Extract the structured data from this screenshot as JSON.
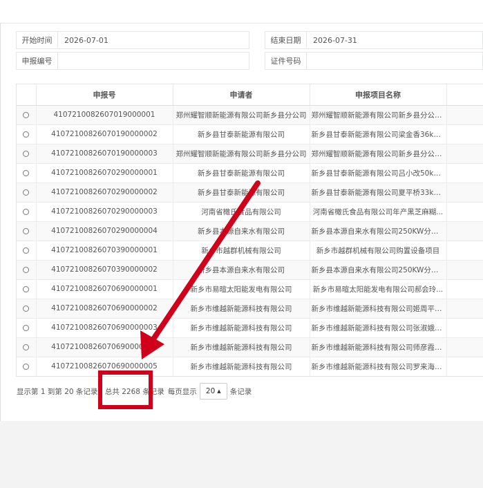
{
  "filters": {
    "start_label": "开始时间",
    "start_value": "2026-07-01",
    "end_label": "结束日期",
    "end_value": "2026-07-31",
    "report_no_label": "申报编号",
    "report_no_value": "",
    "cert_label": "证件号码",
    "cert_value": ""
  },
  "table": {
    "columns": [
      "申报号",
      "申请者",
      "申报项目名称"
    ],
    "rows": [
      {
        "no": "410721008260701900000​1",
        "applicant": "郑州耀智顺新能源有限公司新乡县分公司",
        "project": "郑州耀智顺新能源有限公司新乡县分公司..."
      },
      {
        "no": "41072100826070190000002",
        "applicant": "新乡县甘泰新能源有限公司",
        "project": "新乡县甘泰新能源有限公司梁金香36kW..."
      },
      {
        "no": "41072100826070190000003",
        "applicant": "郑州耀智顺新能源有限公司新乡县分公司",
        "project": "郑州耀智顺新能源有限公司新乡县分公司..."
      },
      {
        "no": "41072100826070290000001",
        "applicant": "新乡县甘泰新能源有限公司",
        "project": "新乡县甘泰新能源有限公司吕小改50kW..."
      },
      {
        "no": "41072100826070290000002",
        "applicant": "新乡县甘泰新能源有限公司",
        "project": "新乡县甘泰新能源有限公司夏平桥33kW..."
      },
      {
        "no": "41072100826070290000003",
        "applicant": "河南省橄氏食品有限公司",
        "project": "河南省橄氏食品有限公司年产黑芝麻糊..."
      },
      {
        "no": "41072100826070290000004",
        "applicant": "新乡县本源自来水有限公司",
        "project": "新乡县本源自来水有限公司250KW分布..."
      },
      {
        "no": "41072100826070390000001",
        "applicant": "新乡市越群机械有限公司",
        "project": "新乡市越群机械有限公司购置设备项目"
      },
      {
        "no": "41072100826070390000002",
        "applicant": "新乡县本源自来水有限公司",
        "project": "新乡县本源自来水有限公司250KW分布..."
      },
      {
        "no": "41072100826070690000001",
        "applicant": "新乡市易暄太阳能发电有限公司",
        "project": "新乡市易暄太阳能发电有限公司郝会玲..."
      },
      {
        "no": "41072100826070690000002",
        "applicant": "新乡市维越新能源科技有限公司",
        "project": "新乡市维越新能源科技有限公司姬周平3..."
      },
      {
        "no": "41072100826070690000003",
        "applicant": "新乡市维越新能源科技有限公司",
        "project": "新乡市维越新能源科技有限公司张淑娥9..."
      },
      {
        "no": "41072100826070690000004",
        "applicant": "新乡市维越新能源科技有限公司",
        "project": "新乡市维越新能源科技有限公司师彦霞6..."
      },
      {
        "no": "41072100826070690000005",
        "applicant": "新乡市维越新能源科技有限公司",
        "project": "新乡市维越新能源科技有限公司罗来海2..."
      }
    ]
  },
  "pagination": {
    "summary": "显示第 1 到第 20 条记录，总共 2268 条记录",
    "per_page_prefix": "每页显示",
    "per_page_value": "20",
    "per_page_suffix": "条记录"
  },
  "annotation": {
    "arrow_color": "#d0021b"
  }
}
